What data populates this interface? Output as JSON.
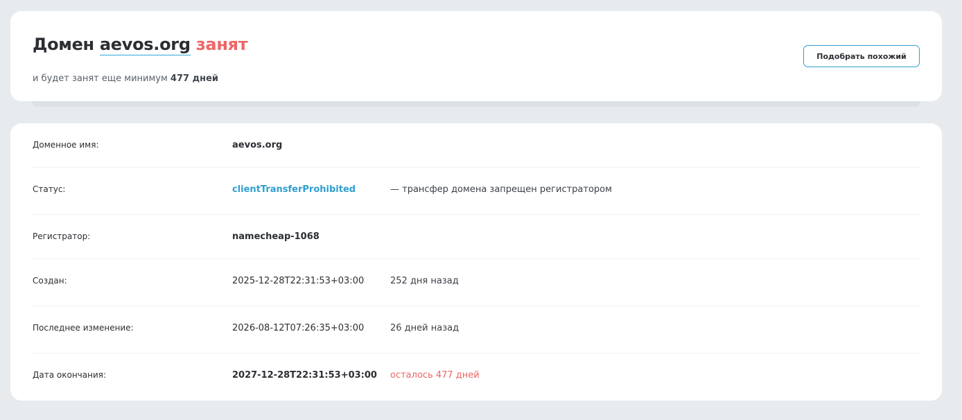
{
  "header": {
    "title_prefix": "Домен",
    "domain": "aevos.org",
    "status_word": "занят",
    "subtitle_prefix": "и будет занят еще минимум",
    "subtitle_days": "477 дней",
    "similar_button_label": "Подобрать похожий"
  },
  "details": {
    "domain_name": {
      "label": "Доменное имя:",
      "value": "aevos.org"
    },
    "status": {
      "label": "Статус:",
      "value": "clientTransferProhibited",
      "note": "— трансфер домена запрещен регистратором"
    },
    "registrar": {
      "label": "Регистратор:",
      "value": "namecheap-1068"
    },
    "created": {
      "label": "Создан:",
      "value": "2025-12-28T22:31:53+03:00",
      "note": "252 дня назад"
    },
    "updated": {
      "label": "Последнее изменение:",
      "value": "2026-08-12T07:26:35+03:00",
      "note": "26 дней назад"
    },
    "expires": {
      "label": "Дата окончания:",
      "value": "2027-12-28T22:31:53+03:00",
      "note": "осталось 477 дней"
    }
  },
  "colors": {
    "accent": "#2f9ed0",
    "danger": "#ef6565",
    "background": "#e8ebee",
    "card": "#ffffff"
  }
}
